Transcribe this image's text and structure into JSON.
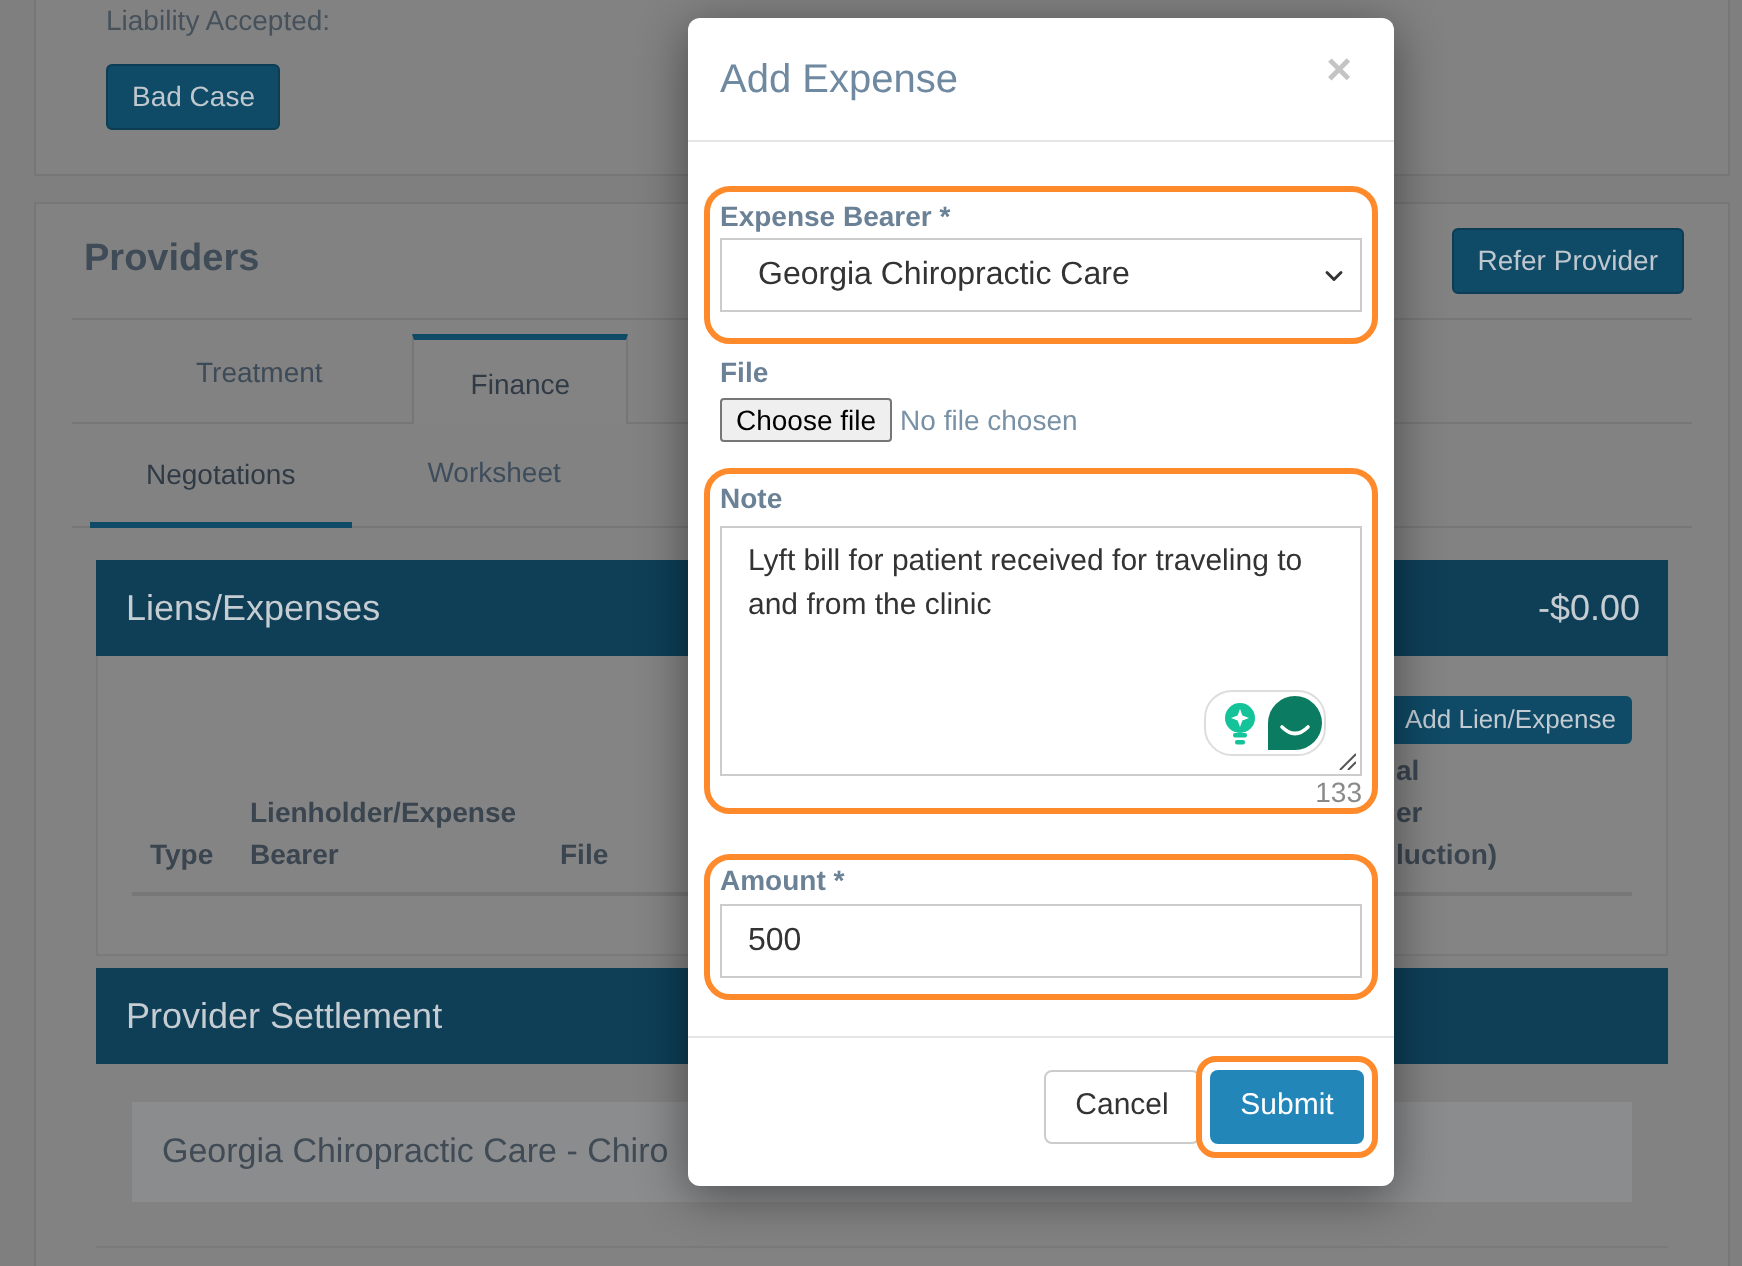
{
  "page": {
    "top_card": {
      "label": "Liability Accepted:",
      "button": "Bad Case"
    },
    "providers": {
      "title": "Providers",
      "refer_button": "Refer Provider",
      "tabs": [
        {
          "label": "Treatment",
          "selected": false
        },
        {
          "label": "Finance",
          "selected": true
        }
      ],
      "subtabs": [
        {
          "label": "Negotations",
          "selected": true
        },
        {
          "label": "Worksheet",
          "selected": false
        }
      ],
      "liens": {
        "title": "Liens/Expenses",
        "total": "-$0.00",
        "add_button": "Add Lien/Expense",
        "columns": [
          {
            "lines": [
              "Type"
            ]
          },
          {
            "lines": [
              "Lienholder/Expense",
              "Bearer"
            ]
          },
          {
            "lines": [
              "File"
            ]
          },
          {
            "lines": [
              "al",
              "er",
              "luction)"
            ]
          }
        ]
      },
      "settlement": {
        "title": "Provider Settlement",
        "rows": [
          "Georgia Chiropractic Care - Chiro"
        ]
      }
    }
  },
  "dialog": {
    "title": "Add Expense",
    "close": "×",
    "fields": [
      {
        "kind": "select",
        "label": "Expense Bearer *",
        "value": "Georgia Chiropractic Care",
        "highlighted": true
      },
      {
        "kind": "file",
        "label": "File",
        "button": "Choose file",
        "status": "No file chosen",
        "highlighted": false
      },
      {
        "kind": "textarea",
        "label": "Note",
        "value": "Lyft bill for patient received for traveling to and from the clinic",
        "counter": "133",
        "highlighted": true
      },
      {
        "kind": "input",
        "label": "Amount *",
        "value": "500",
        "highlighted": true
      }
    ],
    "buttons": [
      {
        "kind": "secondary",
        "label": "Cancel",
        "highlighted": false
      },
      {
        "kind": "primary",
        "label": "Submit",
        "highlighted": true
      }
    ]
  }
}
